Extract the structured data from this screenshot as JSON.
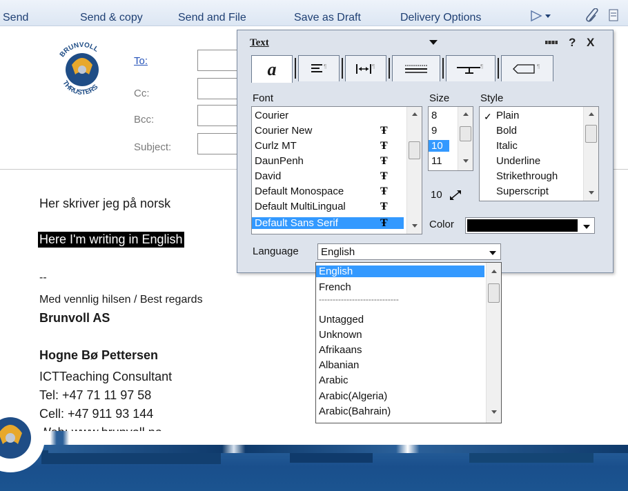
{
  "toolbar": {
    "send": "Send",
    "send_copy": "Send & copy",
    "send_file": "Send and File",
    "save_draft": "Save as Draft",
    "delivery": "Delivery Options"
  },
  "header": {
    "to": "To:",
    "cc": "Cc:",
    "bcc": "Bcc:",
    "subject": "Subject:"
  },
  "body": {
    "line1": "Her skriver jeg på norsk",
    "line2": "Here I'm writing in English",
    "sig_dash": "--",
    "regards": "Med vennlig hilsen / Best regards",
    "company": "Brunvoll AS",
    "name": "Hogne Bø Pettersen",
    "title": "ICTTeaching Consultant",
    "tel": "Tel: +47 71 11 97 58",
    "cell": "Cell: +47 911 93 144",
    "web": "Web: www.brunvoll.no"
  },
  "dialog": {
    "title": "Text",
    "help": "?",
    "close": "X",
    "font_label": "Font",
    "size_label": "Size",
    "style_label": "Style",
    "fonts": [
      "Courier",
      "Courier New",
      "Curlz MT",
      "DaunPenh",
      "David",
      "Default Monospace",
      "Default MultiLingual",
      "Default Sans Serif"
    ],
    "selected_font": "Default Sans Serif",
    "sizes": [
      "8",
      "9",
      "10",
      "11"
    ],
    "selected_size": "10",
    "size_value": "10",
    "styles": [
      "Plain",
      "Bold",
      "Italic",
      "Underline",
      "Strikethrough",
      "Superscript"
    ],
    "selected_style": "Plain",
    "color_label": "Color",
    "color_value": "#000000",
    "language_label": "Language",
    "language_value": "English"
  },
  "language_list": {
    "items": [
      "English",
      "French",
      "-----------------------------",
      "Untagged",
      "Unknown",
      "Afrikaans",
      "Albanian",
      "Arabic",
      "Arabic(Algeria)",
      "Arabic(Bahrain)"
    ],
    "selected": "English"
  },
  "icons": {
    "font_glyph": "Ŧ"
  }
}
